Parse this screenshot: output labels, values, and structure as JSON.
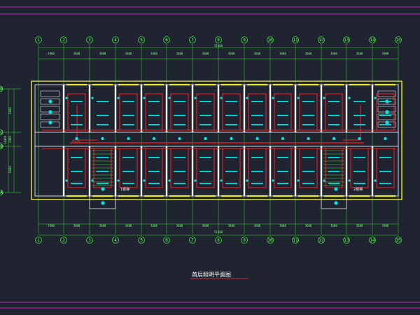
{
  "colors": {
    "background": "#1f2430",
    "grid": "#38e038",
    "wall": "#ffffff",
    "outline": "#e8e838",
    "wiring": "#ff2020",
    "fixture": "#00e5e5",
    "border": "#c020c0"
  },
  "axes": {
    "columns": [
      "1",
      "2",
      "3",
      "4",
      "5",
      "6",
      "7",
      "8",
      "9",
      "10",
      "11",
      "12",
      "13",
      "14",
      "15"
    ],
    "rows": [
      "D",
      "C",
      "B",
      "A"
    ],
    "top_dims": [
      "3900",
      "3600",
      "3600",
      "3600",
      "3600",
      "3600",
      "3600",
      "3600",
      "3600",
      "3600",
      "3600",
      "3600",
      "3600",
      "3900"
    ],
    "top_total": "51400",
    "bottom_dims": [
      "3900",
      "3600",
      "3600",
      "3600",
      "3600",
      "3600",
      "3600",
      "3600",
      "3600",
      "3600",
      "3600",
      "3600",
      "3600",
      "3900"
    ],
    "bottom_total": "51400",
    "left_dims": [
      "6000",
      "2400",
      "6000"
    ],
    "left_total": "14400"
  },
  "labels": {
    "stair_left": "1楼梯",
    "stair_right": "2楼梯",
    "distribution_box": "ALx1"
  },
  "caption": "首层照明平面图"
}
